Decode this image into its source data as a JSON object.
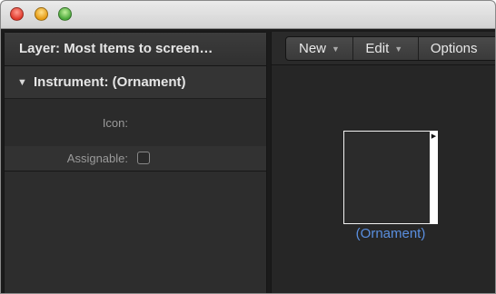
{
  "window": {
    "controls": {
      "close_icon": "close-icon",
      "minimize_icon": "minimize-icon",
      "zoom_icon": "zoom-icon"
    }
  },
  "inspector": {
    "layer_title": "Layer: Most Items to screen…",
    "section": {
      "disclosure_icon": "disclosure-triangle-down-icon",
      "title": "Instrument: (Ornament)"
    },
    "fields": {
      "icon_label": "Icon:",
      "assignable_label": "Assignable:",
      "assignable_checked": false
    }
  },
  "toolbar": {
    "new_label": "New",
    "edit_label": "Edit",
    "options_label": "Options",
    "menu_arrow": "▼"
  },
  "canvas": {
    "object_label": "(Ornament)",
    "label_color": "#5a8fe0"
  },
  "colors": {
    "title_bar": "#d8d8d8",
    "pane_bg": "#2d2d2d",
    "canvas_bg": "#262626",
    "close": "#e0392b",
    "minimize": "#e69b13",
    "zoom": "#49a73a"
  }
}
